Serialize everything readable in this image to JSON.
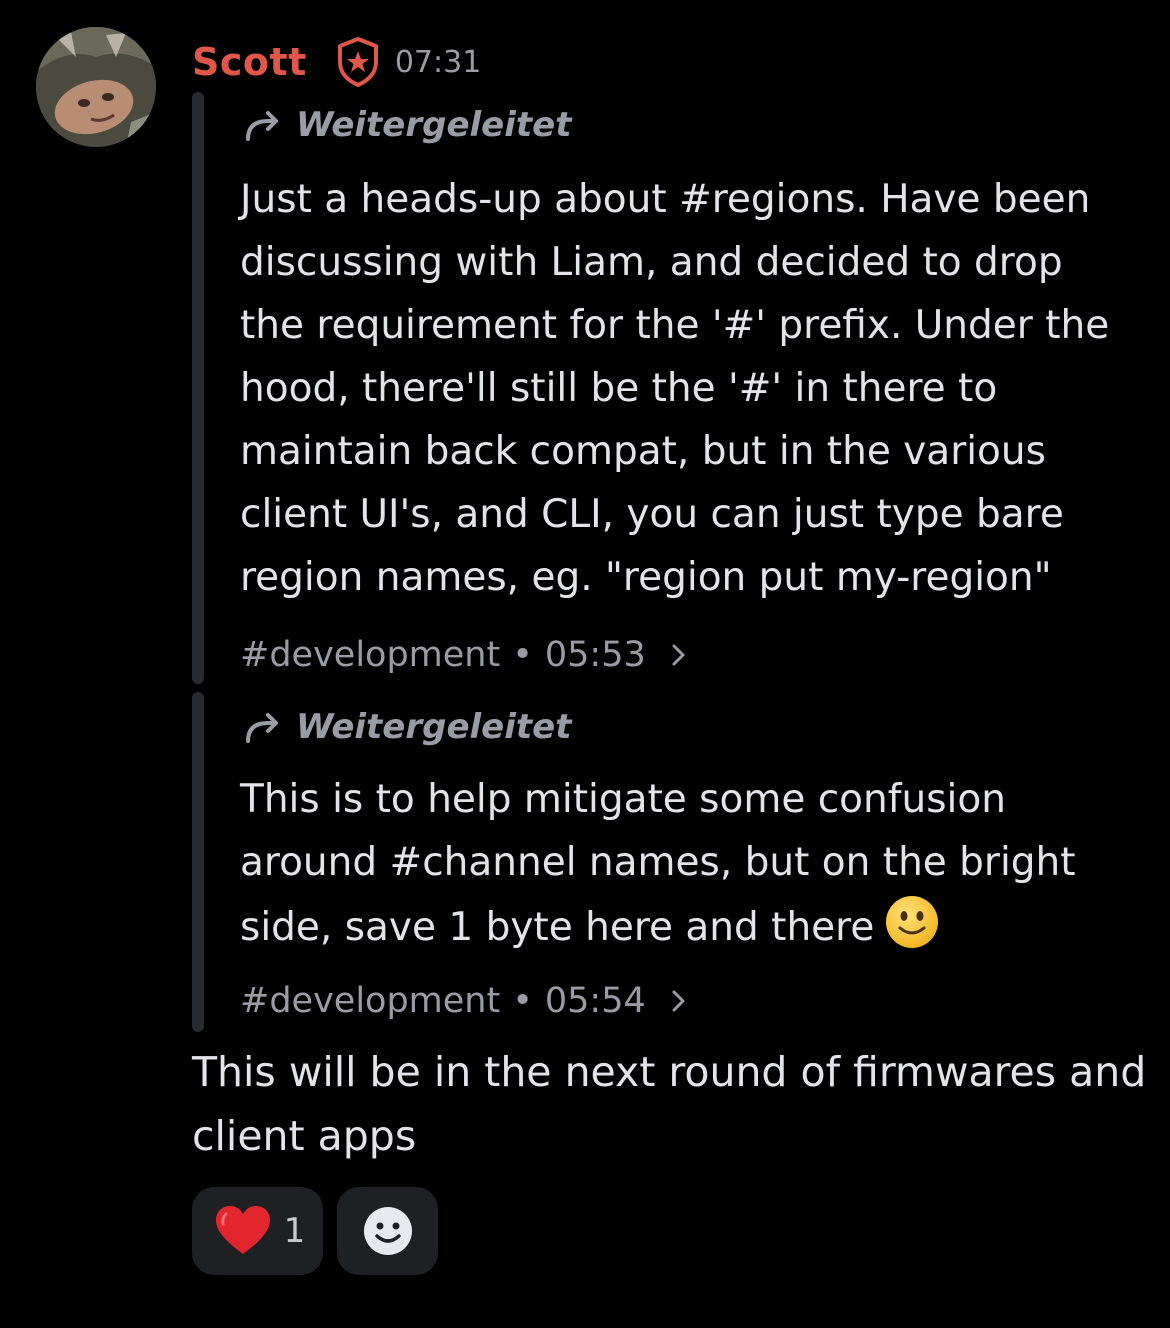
{
  "message": {
    "author": "Scott",
    "time": "07:31",
    "avatar_icon": "user-avatar",
    "role_icon": "shield-star-icon",
    "username_color": "#e0574a",
    "forwards": [
      {
        "label": "Weitergeleitet",
        "body": "Just a heads-up about #regions. Have been\ndiscussing with Liam, and decided to drop\nthe requirement for the '#' prefix. Under the\nhood, there'll still be the '#' in there to\nmaintain back compat, but in the various\nclient UI's, and CLI, you can just type bare\nregion names, eg. \"region put my-region\"",
        "channel": "#development",
        "separator": "•",
        "time": "05:53"
      },
      {
        "label": "Weitergeleitet",
        "body": "This is to help mitigate some confusion\naround #channel names, but on the bright\nside, save 1 byte here and there",
        "emoji": "slightly-smiling-face",
        "channel": "#development",
        "separator": "•",
        "time": "05:54"
      }
    ],
    "text": "This will be in the next round of firmwares and client apps",
    "reactions": [
      {
        "emoji": "red-heart",
        "count": "1"
      },
      {
        "emoji": "add-reaction-icon"
      }
    ]
  }
}
